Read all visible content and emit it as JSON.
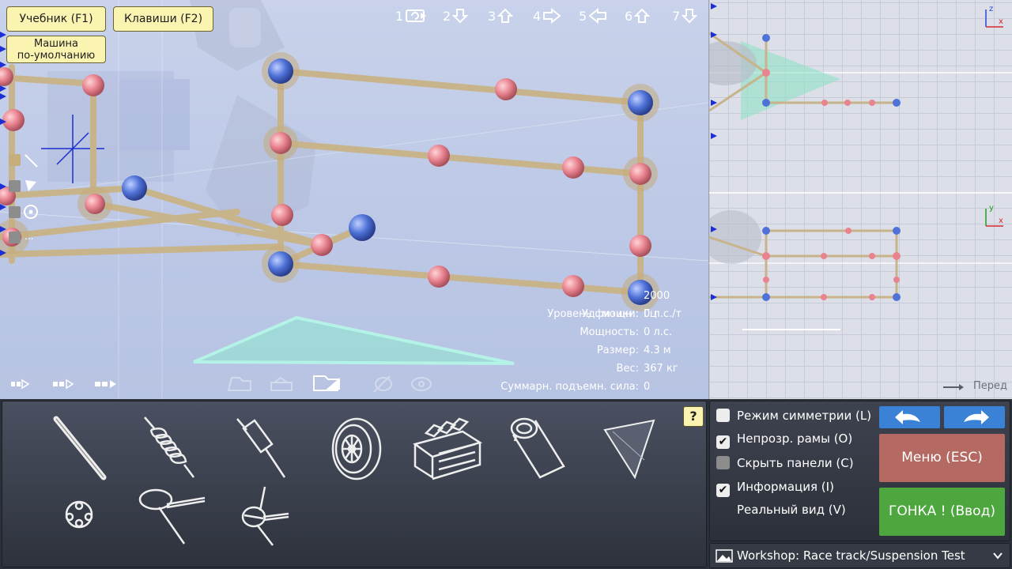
{
  "top_buttons": {
    "tutorial": "Учебник (F1)",
    "keys": "Клавиши (F2)",
    "default_car_line1": "Машина",
    "default_car_line2": "по-умолчанию"
  },
  "views": [
    {
      "num": "1",
      "icon": "rotate-view-icon"
    },
    {
      "num": "2",
      "icon": "arrow-down-icon"
    },
    {
      "num": "3",
      "icon": "arrow-up-icon"
    },
    {
      "num": "4",
      "icon": "arrow-right-icon"
    },
    {
      "num": "5",
      "icon": "arrow-left-icon"
    },
    {
      "num": "6",
      "icon": "arrow-up-icon"
    },
    {
      "num": "7",
      "icon": "arrow-down-icon"
    }
  ],
  "stats": [
    {
      "label": "Уровень физики:",
      "value": "2000 Гц"
    },
    {
      "label": "Уд. мощн.:",
      "value": "0 л.с./т"
    },
    {
      "label": "Мощность:",
      "value": "0 л.с."
    },
    {
      "label": "Размер:",
      "value": "4.3 м"
    },
    {
      "label": "Вес:",
      "value": "367 кг"
    },
    {
      "label": "Суммарн. подъемн. сила:",
      "value": "0"
    }
  ],
  "side_views": {
    "front_label": "Перед",
    "axes_top": {
      "a": "z",
      "b": "x"
    },
    "axes_bottom": {
      "a": "y",
      "b": "x"
    }
  },
  "parts": [
    {
      "name": "beam-part"
    },
    {
      "name": "spring-part"
    },
    {
      "name": "piston-part"
    },
    {
      "name": "wheel-part"
    },
    {
      "name": "engine-part"
    },
    {
      "name": "jet-part"
    },
    {
      "name": "wing-part"
    },
    {
      "name": "node-part"
    },
    {
      "name": "steering-part"
    },
    {
      "name": "rotator-part"
    }
  ],
  "help_label": "?",
  "options": [
    {
      "label": "Режим симметрии (L)",
      "state": "unchecked"
    },
    {
      "label": "Непрозр. рамы (O)",
      "state": "checked"
    },
    {
      "label": "Скрыть панели (C)",
      "state": "disabled"
    },
    {
      "label": "Информация (I)",
      "state": "checked"
    },
    {
      "label": "Реальный вид (V)",
      "state": "none"
    }
  ],
  "buttons": {
    "menu": "Меню (ESC)",
    "race": "ГОНКА ! (Ввод)"
  },
  "level": {
    "prefix": "Workshop:",
    "name": "Race track/Suspension Test"
  },
  "colors": {
    "beam": "#c8b48a",
    "node_pink": "#e8838f",
    "node_blue": "#4f72d8",
    "menu_button": "#b46a63",
    "race_button": "#4ea63f",
    "undo_redo": "#3a82d6"
  }
}
